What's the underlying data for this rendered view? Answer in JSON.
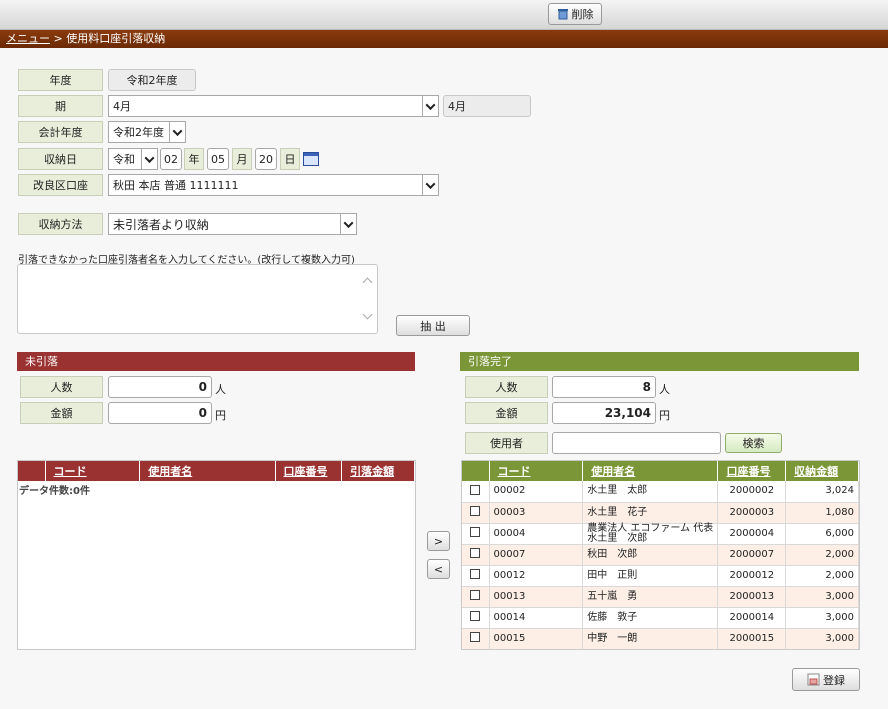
{
  "toolbar": {
    "delete_label": "削除"
  },
  "breadcrumb": {
    "menu_link": "メニュー",
    "separator": ">",
    "current": "使用料口座引落収納"
  },
  "form": {
    "year_label": "年度",
    "year_value": "令和2年度",
    "period_label": "期",
    "period_value": "4月",
    "period_display": "4月",
    "fiscal_year_label": "会計年度",
    "fiscal_year_value": "令和2年度",
    "receipt_date_label": "収納日",
    "era_value": "令和",
    "year_num": "02",
    "year_unit": "年",
    "month_num": "05",
    "month_unit": "月",
    "day_num": "20",
    "day_unit": "日",
    "account_label": "改良区口座",
    "account_value": "秋田 本店 普通 1111111",
    "method_label": "収納方法",
    "method_value": "未引落者より収納",
    "instruction": "引落できなかった口座引落者名を入力してください。(改行して複数入力可)",
    "textarea_value": "",
    "extract_label": "抽 出"
  },
  "unpaid": {
    "header": "未引落",
    "count_label": "人数",
    "count_value": "0",
    "count_unit": "人",
    "amount_label": "金額",
    "amount_value": "0",
    "amount_unit": "円",
    "columns": [
      "コード",
      "使用者名",
      "口座番号",
      "引落金額"
    ],
    "record_count": "データ件数:0件"
  },
  "done": {
    "header": "引落完了",
    "count_label": "人数",
    "count_value": "8",
    "count_unit": "人",
    "amount_label": "金額",
    "amount_value": "23,104",
    "amount_unit": "円",
    "user_label": "使用者",
    "user_value": "",
    "search_label": "検索",
    "columns": [
      "コード",
      "使用者名",
      "口座番号",
      "収納金額"
    ],
    "rows": [
      {
        "code": "00002",
        "name": "水土里　太郎",
        "account": "2000002",
        "amount": "3,024"
      },
      {
        "code": "00003",
        "name": "水土里　花子",
        "account": "2000003",
        "amount": "1,080"
      },
      {
        "code": "00004",
        "name": "農業法人 エコファーム 代表 水土里　次郎",
        "account": "2000004",
        "amount": "6,000"
      },
      {
        "code": "00007",
        "name": "秋田　次郎",
        "account": "2000007",
        "amount": "2,000"
      },
      {
        "code": "00012",
        "name": "田中　正則",
        "account": "2000012",
        "amount": "2,000"
      },
      {
        "code": "00013",
        "name": "五十嵐　勇",
        "account": "2000013",
        "amount": "3,000"
      },
      {
        "code": "00014",
        "name": "佐藤　敦子",
        "account": "2000014",
        "amount": "3,000"
      },
      {
        "code": "00015",
        "name": "中野　一朗",
        "account": "2000015",
        "amount": "3,000"
      }
    ]
  },
  "move": {
    "right_label": ">",
    "left_label": "<"
  },
  "footer": {
    "register_label": "登録"
  }
}
